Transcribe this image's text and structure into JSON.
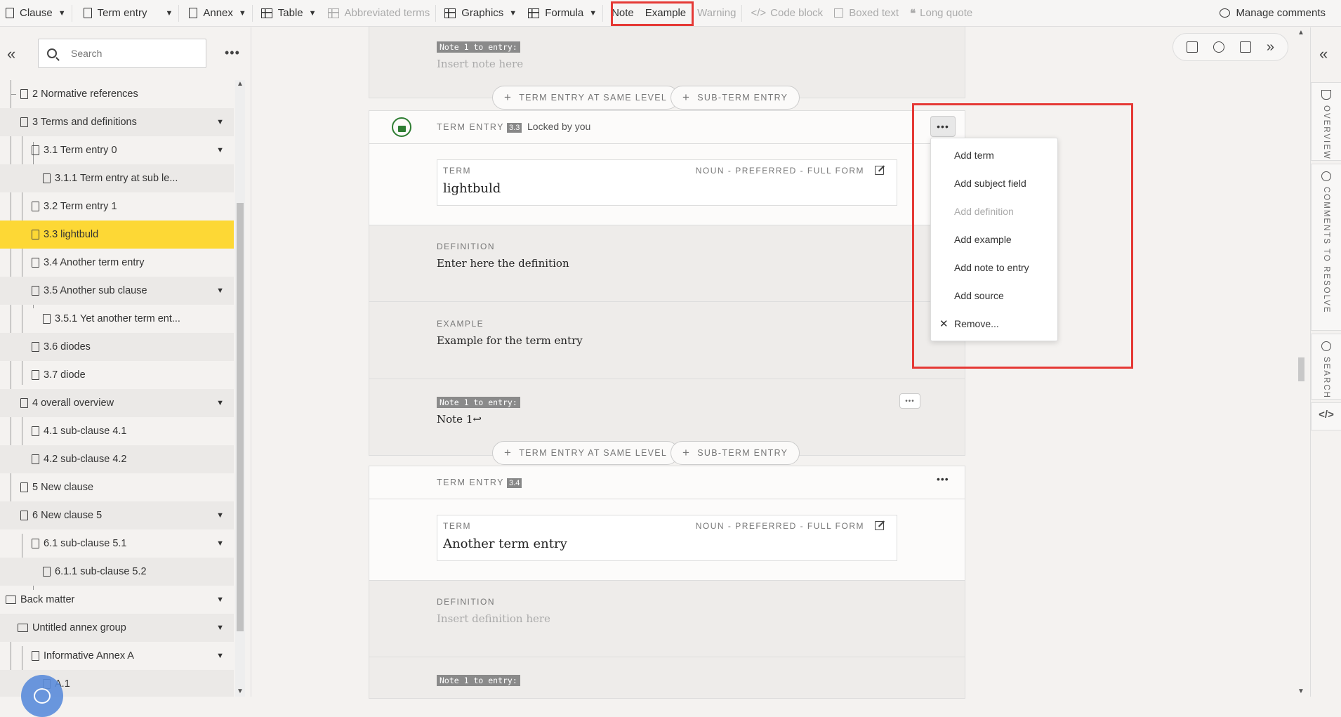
{
  "toolbar": {
    "items": [
      {
        "label": "Clause",
        "icon": "document-icon",
        "dropdown": true
      },
      {
        "label": "Term entry",
        "icon": "document-icon",
        "dropdown": true
      },
      {
        "label": "Annex",
        "icon": "document-icon",
        "dropdown": true
      },
      {
        "label": "Table",
        "icon": "table-icon",
        "dropdown": true
      },
      {
        "label": "Abbreviated terms",
        "icon": "table-grid-icon",
        "disabled": true
      },
      {
        "label": "Graphics",
        "icon": "image-icon",
        "dropdown": true
      },
      {
        "label": "Formula",
        "icon": "calculator-icon",
        "dropdown": true
      },
      {
        "label": "Note"
      },
      {
        "label": "Example"
      },
      {
        "label": "Warning",
        "disabled": true
      },
      {
        "label": "Code block",
        "icon": "code-icon",
        "disabled": true
      },
      {
        "label": "Boxed text",
        "icon": "box-icon",
        "disabled": true
      },
      {
        "label": "Long quote",
        "icon": "quote-icon",
        "disabled": true
      }
    ],
    "manage_comments": "Manage comments"
  },
  "left_panel": {
    "search_placeholder": "Search",
    "tree": [
      {
        "label": "2 Normative references",
        "level": 1,
        "caret": false
      },
      {
        "label": "3 Terms and definitions",
        "level": 1,
        "caret": true
      },
      {
        "label": "3.1 Term entry 0",
        "level": 2,
        "caret": true
      },
      {
        "label": "3.1.1 Term entry at sub le...",
        "level": 3,
        "caret": false
      },
      {
        "label": "3.2 Term entry 1",
        "level": 2,
        "caret": false
      },
      {
        "label": "3.3 lightbuld",
        "level": 2,
        "caret": false,
        "selected": true
      },
      {
        "label": "3.4 Another term entry",
        "level": 2,
        "caret": false
      },
      {
        "label": "3.5 Another sub clause",
        "level": 2,
        "caret": true
      },
      {
        "label": "3.5.1 Yet another term ent...",
        "level": 3,
        "caret": false
      },
      {
        "label": "3.6 diodes",
        "level": 2,
        "caret": false
      },
      {
        "label": "3.7 diode",
        "level": 2,
        "caret": false
      },
      {
        "label": "4 overall overview",
        "level": 1,
        "caret": true
      },
      {
        "label": "4.1 sub-clause 4.1",
        "level": 2,
        "caret": false
      },
      {
        "label": "4.2 sub-clause 4.2",
        "level": 2,
        "caret": false
      },
      {
        "label": "5 New clause",
        "level": 1,
        "caret": false
      },
      {
        "label": "6 New clause 5",
        "level": 1,
        "caret": true
      },
      {
        "label": "6.1 sub-clause 5.1",
        "level": 2,
        "caret": true
      },
      {
        "label": "6.1.1 sub-clause 5.2",
        "level": 3,
        "caret": false
      },
      {
        "label": "Back matter",
        "level": 0,
        "caret": true,
        "folder": true
      },
      {
        "label": "Untitled annex group",
        "level": 1,
        "caret": true,
        "folder": true
      },
      {
        "label": "Informative Annex A",
        "level": 2,
        "caret": true
      },
      {
        "label": "A.1",
        "level": 3,
        "caret": false
      }
    ]
  },
  "document": {
    "top_note": {
      "label": "Note 1 to entry:",
      "placeholder": "Insert note here"
    },
    "add_same_level": "TERM ENTRY AT SAME LEVEL",
    "add_sub_term": "SUB-TERM ENTRY",
    "entry_33": {
      "header": "TERM ENTRY",
      "number": "3.3",
      "lock_status": "Locked by you",
      "term_label": "TERM",
      "term_meta": "NOUN - PREFERRED - FULL FORM",
      "term_value": "lightbuld",
      "definition_label": "DEFINITION",
      "definition_value": "Enter here the definition",
      "example_label": "EXAMPLE",
      "example_value": "Example for the term entry",
      "note_label": "Note 1 to entry:",
      "note_value": "Note 1↩"
    },
    "entry_34": {
      "header": "TERM ENTRY",
      "number": "3.4",
      "term_label": "TERM",
      "term_meta": "NOUN - PREFERRED - FULL FORM",
      "term_value": "Another term entry",
      "definition_label": "DEFINITION",
      "definition_placeholder": "Insert definition here",
      "note_label": "Note 1 to entry:"
    }
  },
  "context_menu": {
    "items": [
      {
        "label": "Add term",
        "disabled": false
      },
      {
        "label": "Add subject field",
        "disabled": false
      },
      {
        "label": "Add definition",
        "disabled": true
      },
      {
        "label": "Add example",
        "disabled": false
      },
      {
        "label": "Add note to entry",
        "disabled": false
      },
      {
        "label": "Add source",
        "disabled": false
      },
      {
        "label": "Remove...",
        "disabled": false,
        "icon": "close-icon"
      }
    ]
  },
  "right_sidebar": {
    "tabs": [
      "OVERVIEW",
      "COMMENTS TO RESOLVE",
      "SEARCH"
    ]
  },
  "colors": {
    "highlight": "#e53935",
    "selected_row": "#fdd835",
    "lock_green": "#2e7d32"
  }
}
